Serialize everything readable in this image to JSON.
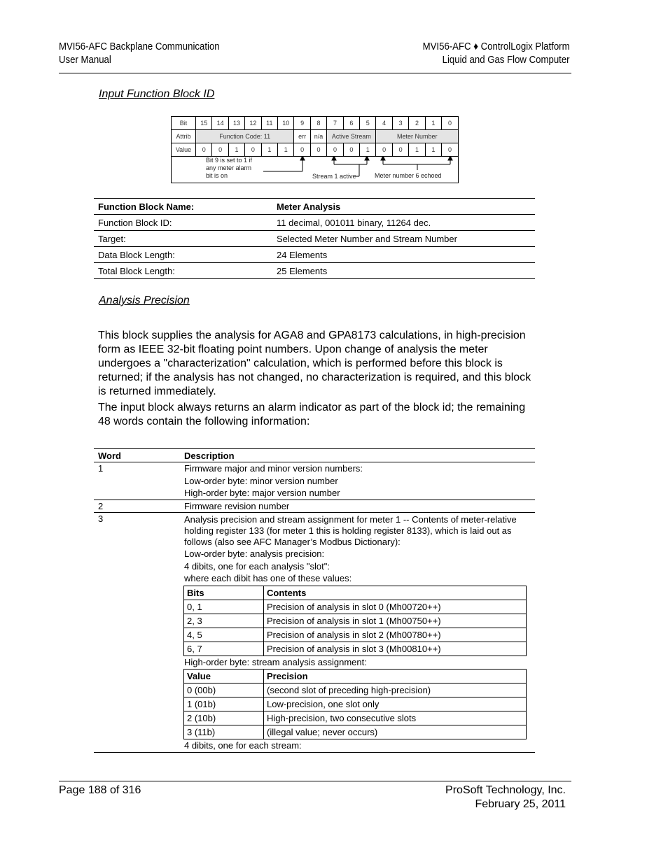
{
  "header": {
    "left_line1": "MVI56-AFC Backplane Communication",
    "left_line2": "User Manual",
    "right_line1": "MVI56-AFC ♦ ControlLogix Platform",
    "right_line2": "Liquid and Gas Flow Computer"
  },
  "section1": {
    "title": "Input Function Block ID"
  },
  "bit_diagram": {
    "row_labels": [
      "Bit",
      "Attrib",
      "Value"
    ],
    "bits": [
      "15",
      "14",
      "13",
      "12",
      "11",
      "10",
      "9",
      "8",
      "7",
      "6",
      "5",
      "4",
      "3",
      "2",
      "1",
      "0"
    ],
    "attribs": {
      "function_code": "Function Code: 11",
      "err": "err",
      "na": "n/a",
      "active_stream": "Active Stream",
      "meter_number": "Meter Number"
    },
    "values": [
      "0",
      "0",
      "1",
      "0",
      "1",
      "1",
      "0",
      "0",
      "0",
      "0",
      "1",
      "0",
      "0",
      "1",
      "1",
      "0"
    ],
    "notes": {
      "bit9": "Bit 9 is set to 1 if any meter alarm bit is on",
      "bit9_line1": "Bit 9 is set to 1 if",
      "bit9_line2": "any meter alarm",
      "bit9_line3": "bit is on",
      "stream": "Stream 1 active",
      "meter": "Meter number 6 echoed"
    }
  },
  "function_block_table": {
    "rows": [
      {
        "label": "Function Block Name:",
        "value": "Meter Analysis"
      },
      {
        "label": "Function Block ID:",
        "value": "11 decimal, 001011 binary, 11264 dec."
      },
      {
        "label": "Target:",
        "value": "Selected Meter Number and Stream Number"
      },
      {
        "label": "Data Block Length:",
        "value": "24 Elements"
      },
      {
        "label": "Total Block Length:",
        "value": "25 Elements"
      }
    ]
  },
  "section2": {
    "title": "Analysis Precision",
    "para1": "This block supplies the analysis for AGA8 and GPA8173 calculations, in high-precision form as IEEE 32-bit floating point numbers. Upon change of analysis the meter undergoes a \"characterization\" calculation, which is performed before this block is returned; if the analysis has not changed, no characterization is required, and this block is returned immediately.",
    "para2": "The input block always returns an alarm indicator as part of the block id; the remaining 48 words contain the following information:"
  },
  "word_table": {
    "headers": {
      "word": "Word",
      "description": "Description"
    },
    "rows": [
      {
        "word": "1",
        "lines": [
          "Firmware major and minor version numbers:",
          "Low-order byte: minor version number",
          "High-order byte: major version number"
        ]
      },
      {
        "word": "2",
        "lines": [
          "Firmware revision number"
        ]
      },
      {
        "word": "3",
        "para": "Analysis precision and stream assignment for meter 1 -- Contents of meter-relative holding register 133 (for meter 1 this is holding register 8133), which is laid out as follows (also see AFC Manager’s Modbus Dictionary):",
        "lines": [
          "Low-order byte: analysis precision:",
          "4 dibits, one for each analysis \"slot\":",
          "where each dibit has one of these values:"
        ],
        "bits_table": {
          "headers": [
            "Bits",
            "Contents"
          ],
          "rows": [
            [
              "0, 1",
              "Precision of analysis in slot 0 (Mh00720++)"
            ],
            [
              "2, 3",
              "Precision of analysis in slot 1 (Mh00750++)"
            ],
            [
              "4, 5",
              "Precision of analysis in slot 2 (Mh00780++)"
            ],
            [
              "6, 7",
              "Precision of analysis in slot 3 (Mh00810++)"
            ]
          ]
        },
        "high_byte_line": "High-order byte: stream analysis assignment:",
        "value_table": {
          "headers": [
            "Value",
            "Precision"
          ],
          "rows": [
            [
              "0 (00b)",
              "(second slot of preceding high-precision)"
            ],
            [
              "1 (01b)",
              "Low-precision, one slot only"
            ],
            [
              "2 (10b)",
              "High-precision, two consecutive slots"
            ],
            [
              "3 (11b)",
              "(illegal value; never occurs)"
            ]
          ]
        },
        "last_line": "4 dibits, one for each stream:"
      }
    ]
  },
  "footer": {
    "page": "Page 188 of 316",
    "company": "ProSoft Technology, Inc.",
    "date": "February 25, 2011"
  }
}
